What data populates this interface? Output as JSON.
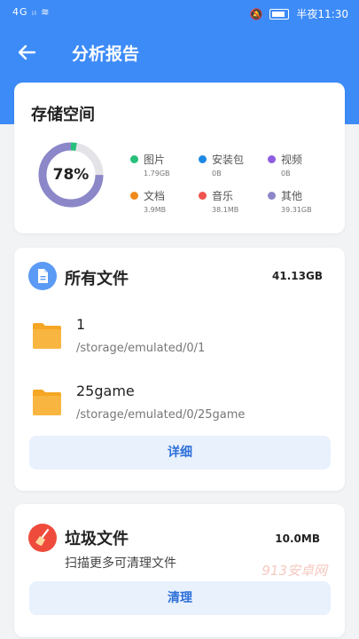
{
  "status_bar": {
    "left": "4G ᵢₗ ≋",
    "time": "半夜11:30"
  },
  "header": {
    "title": "分析报告"
  },
  "storage": {
    "title": "存储空间",
    "percent_label": "78%",
    "used_fraction": 0.78,
    "colors": {
      "ring_main": "#8b87c9",
      "ring_rest": "#e4e4e8",
      "ring_green": "#27c07b"
    },
    "legend": [
      {
        "name": "图片",
        "size": "1.79GB",
        "color": "#27c07b"
      },
      {
        "name": "安装包",
        "size": "0B",
        "color": "#1e88e5"
      },
      {
        "name": "视频",
        "size": "0B",
        "color": "#8e5de0"
      },
      {
        "name": "文档",
        "size": "3.9MB",
        "color": "#f08a1c"
      },
      {
        "name": "音乐",
        "size": "38.1MB",
        "color": "#ef5350"
      },
      {
        "name": "其他",
        "size": "39.31GB",
        "color": "#8b87c9"
      }
    ]
  },
  "all_files": {
    "title": "所有文件",
    "size": "41.13GB",
    "folders": [
      {
        "name": "1",
        "path": "/storage/emulated/0/1"
      },
      {
        "name": "25game",
        "path": "/storage/emulated/0/25game"
      }
    ],
    "detail_button": "详细"
  },
  "junk": {
    "title": "垃圾文件",
    "size": "10.0MB",
    "subtitle": "扫描更多可清理文件",
    "clean_button": "清理",
    "watermark": "913安卓网"
  }
}
